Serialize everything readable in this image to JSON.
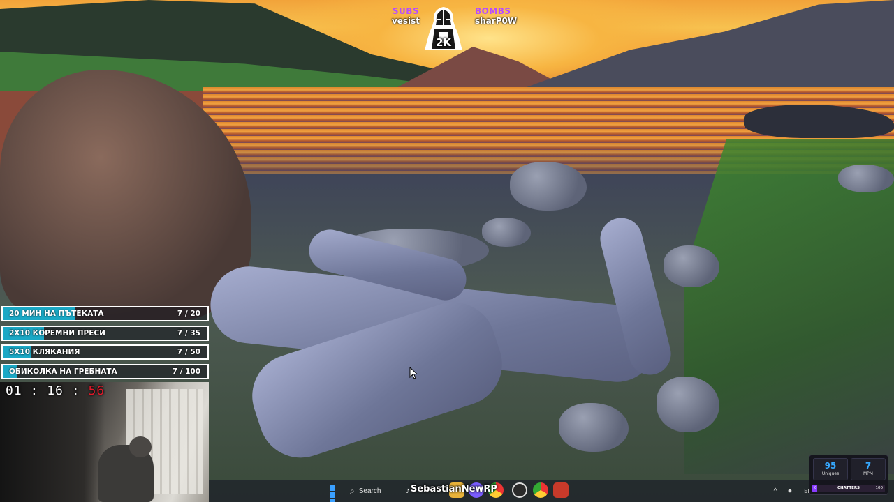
{
  "overlay": {
    "subs_label": "SUBS",
    "subs_value": "vesist",
    "bombs_label": "BOMBS",
    "bombs_value": "sharP0W",
    "mascot_badge": "2K"
  },
  "goals": [
    {
      "label": "20 МИН НА ПЪТЕКАТА",
      "count": "7 / 20",
      "progress": 0.35
    },
    {
      "label": "2Х10 КОРЕМНИ ПРЕСИ",
      "count": "7 / 35",
      "progress": 0.2
    },
    {
      "label": "5Х10 КЛЯКАНИЯ",
      "count": "7 / 50",
      "progress": 0.14
    },
    {
      "label": "ОБИКОЛКА НА ГРЕБНАТА",
      "count": "7 / 100",
      "progress": 0.07
    }
  ],
  "timer": {
    "hours": "01",
    "minutes": "16",
    "seconds": "56",
    "separator": ":"
  },
  "taskbar": {
    "search_placeholder": "Search",
    "streamer_name": "SebastianNewRP",
    "tray_lang": "БГ"
  },
  "stats": {
    "uniques_value": "95",
    "uniques_label": "Uniques",
    "mpm_value": "7",
    "mpm_label": "MPM",
    "chatters_label": "CHATTERS",
    "chatters_min": "0",
    "chatters_max": "100",
    "chatters_progress": 0.07
  },
  "colors": {
    "goal_fill": "#1ba8c5",
    "overlay_label": "#b74cff",
    "timer_seconds": "#e0192a",
    "stat_value": "#36a8ff",
    "chatter_fill": "#8a3dff"
  },
  "icons": {
    "start": "windows-start-icon",
    "search": "search-icon",
    "tiktok": "tiktok-icon",
    "mascot": "helmet-mascot-icon",
    "cursor": "mouse-cursor-icon"
  }
}
